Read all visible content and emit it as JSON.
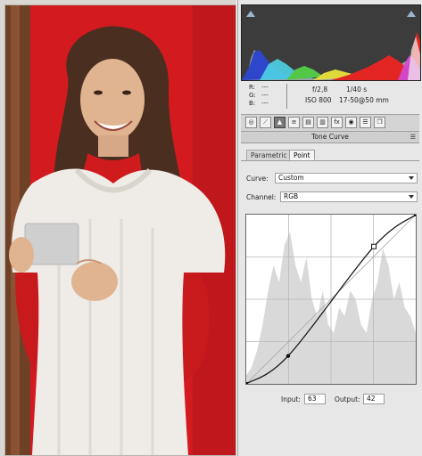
{
  "histogram": {
    "colors": {
      "blue": "#2e46c9",
      "cyan": "#4fd3e6",
      "green": "#53c847",
      "yellow": "#e9e13a",
      "red": "#e32623",
      "magenta": "#d04ad7",
      "white": "#f4f4f4"
    }
  },
  "info": {
    "rgb": [
      {
        "label": "R:",
        "value": "---"
      },
      {
        "label": "G:",
        "value": "---"
      },
      {
        "label": "B:",
        "value": "---"
      }
    ],
    "aperture": "f/2,8",
    "shutter": "1/40 s",
    "iso": "ISO 800",
    "lens": "17-50@50 mm"
  },
  "toolbar": {
    "tools": [
      {
        "name": "basic",
        "glyph": "◎",
        "active": false
      },
      {
        "name": "tone-curve",
        "glyph": "⟋",
        "active": false
      },
      {
        "name": "detail",
        "glyph": "▲",
        "active": true
      },
      {
        "name": "hsl",
        "glyph": "≡",
        "active": false
      },
      {
        "name": "split-toning",
        "glyph": "▤",
        "active": false
      },
      {
        "name": "lens-corrections",
        "glyph": "▥",
        "active": false
      },
      {
        "name": "effects",
        "glyph": "fx",
        "active": false
      },
      {
        "name": "camera-calibration",
        "glyph": "◉",
        "active": false
      },
      {
        "name": "presets",
        "glyph": "☰",
        "active": false
      },
      {
        "name": "snapshots",
        "glyph": "❐",
        "active": false
      }
    ]
  },
  "panel": {
    "title": "Tone Curve",
    "tabs": {
      "parametric": "Parametric",
      "point": "Point"
    },
    "curve_label": "Curve:",
    "curve_value": "Custom",
    "channel_label": "Channel:",
    "channel_value": "RGB",
    "input_label": "Input:",
    "input_value": "63",
    "output_label": "Output:",
    "output_value": "42"
  },
  "curve": {
    "points": [
      [
        0,
        0
      ],
      [
        63,
        42
      ],
      [
        192,
        207
      ],
      [
        255,
        255
      ]
    ],
    "selected_point": [
      63,
      42
    ]
  },
  "photo": {
    "colors": {
      "wall": "#d21a1f",
      "sweater": "#efece7",
      "turtleneck": "#d01b1d",
      "hair": "#4a2e20",
      "skin": "#e1b491",
      "card": "#cfcfcf",
      "door": "#6e4127"
    }
  }
}
